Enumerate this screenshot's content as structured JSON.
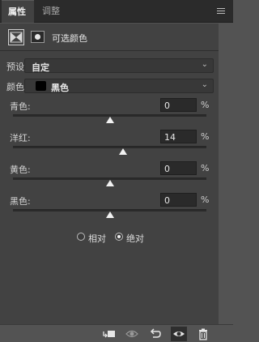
{
  "tabs": {
    "active": "属性",
    "inactive": "调整"
  },
  "panel": {
    "title": "可选颜色"
  },
  "preset": {
    "label": "预设:",
    "value": "自定"
  },
  "color": {
    "label": "颜色:",
    "value": "黑色"
  },
  "sliders": [
    {
      "label": "青色:",
      "value": "0",
      "unit": "%",
      "level": 0
    },
    {
      "label": "洋红:",
      "value": "14",
      "unit": "%",
      "level": 14
    },
    {
      "label": "黄色:",
      "value": "0",
      "unit": "%",
      "level": 0
    },
    {
      "label": "黑色:",
      "value": "0",
      "unit": "%",
      "level": 0
    }
  ],
  "method": {
    "relative": "相对",
    "absolute": "绝对",
    "selected": "absolute"
  },
  "colors": {
    "panel_bg": "#424242",
    "chrome_bg": "#535353",
    "tabbar_bg": "#2b2b2b"
  },
  "bottom_icons": [
    "clip-to-layer-icon",
    "view-previous-icon",
    "reset-icon",
    "visibility-icon",
    "delete-icon"
  ]
}
